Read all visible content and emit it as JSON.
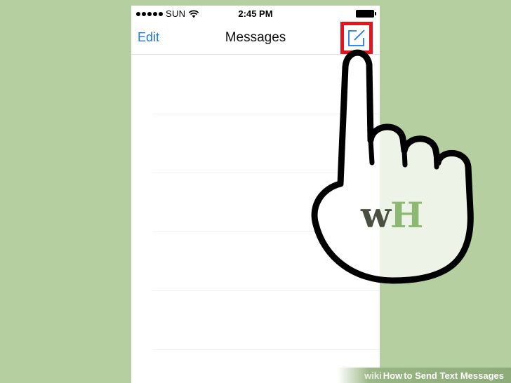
{
  "status_bar": {
    "carrier": "SUN",
    "time": "2:45 PM"
  },
  "nav": {
    "edit_label": "Edit",
    "title": "Messages"
  },
  "hand_logo": {
    "w": "w",
    "h": "H"
  },
  "caption": {
    "wiki": "wiki",
    "how": "How",
    "rest": "to Send Text Messages"
  },
  "colors": {
    "background": "#b6cfa1",
    "ios_blue": "#1e78f0",
    "highlight_red": "#e0151f",
    "logo_dark": "#4a5040",
    "logo_green": "#8cb873"
  },
  "icons": {
    "compose": "compose-icon",
    "wifi": "wifi-icon",
    "battery": "battery-icon",
    "signal": "signal-dots-icon"
  }
}
